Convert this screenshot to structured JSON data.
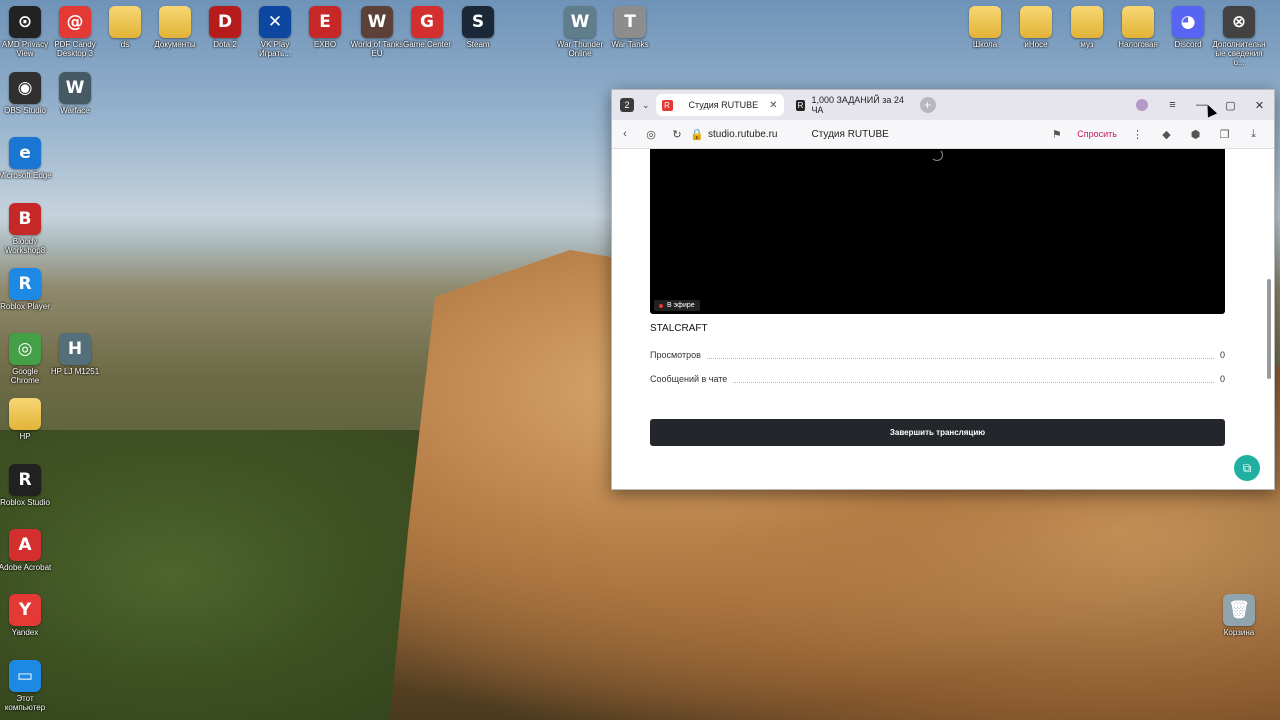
{
  "desktop": {
    "icons": [
      {
        "label": "AMD Privacy View",
        "glyph": "⊙",
        "color": "#222222"
      },
      {
        "label": "PDF Candy Desktop 3",
        "glyph": "@",
        "color": "#e53935"
      },
      {
        "label": "ds",
        "glyph": "",
        "color": "folder"
      },
      {
        "label": "Документы",
        "glyph": "",
        "color": "folder"
      },
      {
        "label": "Dota 2",
        "glyph": "D",
        "color": "#b71c1c"
      },
      {
        "label": "VK Play Играть...",
        "glyph": "✕",
        "color": "#0d47a1"
      },
      {
        "label": "EXBO",
        "glyph": "E",
        "color": "#c62828"
      },
      {
        "label": "World of Tanks EU",
        "glyph": "W",
        "color": "#5d4037"
      },
      {
        "label": "Game Center",
        "glyph": "G",
        "color": "#d32f2f"
      },
      {
        "label": "Steam",
        "glyph": "S",
        "color": "#1b2838"
      },
      {
        "label": "War Thunder Online",
        "glyph": "W",
        "color": "#607d8b"
      },
      {
        "label": "War Tanks",
        "glyph": "T",
        "color": "#8d8d8d"
      },
      {
        "label": "OBS Studio",
        "glyph": "◉",
        "color": "#303030"
      },
      {
        "label": "Warface",
        "glyph": "W",
        "color": "#455a64"
      },
      {
        "label": "Microsoft Edge",
        "glyph": "e",
        "color": "#1976d2"
      },
      {
        "label": "Bloody Workshop8",
        "glyph": "B",
        "color": "#c62828"
      },
      {
        "label": "Roblox Player",
        "glyph": "R",
        "color": "#1e88e5"
      },
      {
        "label": "Google Chrome",
        "glyph": "◎",
        "color": "#43a047"
      },
      {
        "label": "HP LJ M1251",
        "glyph": "H",
        "color": "#546e7a"
      },
      {
        "label": "HP",
        "glyph": "",
        "color": "folder"
      },
      {
        "label": "Roblox Studio",
        "glyph": "R",
        "color": "#212121"
      },
      {
        "label": "Adobe Acrobat",
        "glyph": "A",
        "color": "#d32f2f"
      },
      {
        "label": "Yandex",
        "glyph": "Y",
        "color": "#e53935"
      },
      {
        "label": "Этот компьютер",
        "glyph": "▭",
        "color": "#1e88e5"
      },
      {
        "label": "Школа",
        "glyph": "",
        "color": "folder"
      },
      {
        "label": "иНосе",
        "glyph": "",
        "color": "folder"
      },
      {
        "label": "муз",
        "glyph": "",
        "color": "folder"
      },
      {
        "label": "Налоговая",
        "glyph": "",
        "color": "folder"
      },
      {
        "label": "Discord",
        "glyph": "◕",
        "color": "#5865f2"
      },
      {
        "label": "Дополнительные сведения о...",
        "glyph": "⊗",
        "color": "#424242"
      },
      {
        "label": "Корзина",
        "glyph": "🗑",
        "color": "#90a4ae"
      }
    ]
  },
  "browser": {
    "tab_count": "2",
    "tabs": [
      {
        "label": "Студия RUTUBE",
        "close": "✕",
        "favicon": "R",
        "favicon_color": "#e53935"
      },
      {
        "label": "1,000 ЗАДАНИЙ за 24 ЧА",
        "favicon": "R",
        "favicon_color": "#222222"
      }
    ],
    "new_tab": "+",
    "window_controls": {
      "menu": "≡",
      "minimize": "—",
      "maximize": "▢",
      "close": "✕"
    },
    "address": {
      "url": "studio.rutube.ru",
      "page_title": "Студия RUTUBE",
      "ask_label": "Спросить"
    }
  },
  "page": {
    "live_badge": "В эфире",
    "stream_name": "STALCRAFT",
    "stats": [
      {
        "label": "Просмотров",
        "value": "0"
      },
      {
        "label": "Сообщений в чате",
        "value": "0"
      }
    ],
    "end_button": "Завершить трансляцию"
  }
}
